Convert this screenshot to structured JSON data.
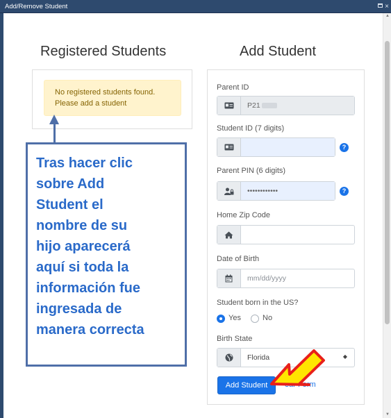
{
  "window": {
    "title": "Add/Remove Student",
    "maximize_label": "",
    "close_label": "×"
  },
  "registered": {
    "heading": "Registered Students",
    "alert_line1": "No registered students found.",
    "alert_line2": "Please add a student"
  },
  "form": {
    "heading": "Add Student",
    "parent_id": {
      "label": "Parent ID",
      "value": "P21"
    },
    "student_id": {
      "label": "Student ID (7 digits)",
      "value": ""
    },
    "parent_pin": {
      "label": "Parent PIN (6 digits)",
      "value": "••••••••••••"
    },
    "zip": {
      "label": "Home Zip Code",
      "value": ""
    },
    "dob": {
      "label": "Date of Birth",
      "placeholder": "mm/dd/yyyy"
    },
    "born_us": {
      "label": "Student born in the US?",
      "yes": "Yes",
      "no": "No",
      "selected": "Yes"
    },
    "birth_state": {
      "label": "Birth State",
      "value": "Florida"
    },
    "help_glyph": "?",
    "add_button": "Add Student",
    "clear_button": "Clear Form",
    "clear_visible": "ear Form"
  },
  "annotation": {
    "text": "Tras hacer clic sobre Add Student el nombre de su hijo aparecerá aquí si toda la información fue ingresada de manera correcta",
    "lines": [
      "Tras hacer clic",
      "sobre Add",
      "Student el",
      "nombre de su",
      "hijo aparecerá",
      "aquí si toda la",
      "información fue",
      "ingresada de",
      "manera correcta"
    ]
  },
  "icons": {
    "id_card": "id-card-icon",
    "user_lock": "user-lock-icon",
    "home": "home-icon",
    "calendar": "calendar-icon",
    "globe": "globe-icon",
    "help": "question-circle-icon"
  },
  "colors": {
    "titlebar": "#2e4a6e",
    "primary": "#1a73e8",
    "alert_bg": "#fff3cd",
    "alert_text": "#856404",
    "callout_border": "#4f6fa8",
    "callout_text": "#2a6ac9",
    "arrow_red": "#e8201a",
    "arrow_yellow": "#ffe600"
  }
}
